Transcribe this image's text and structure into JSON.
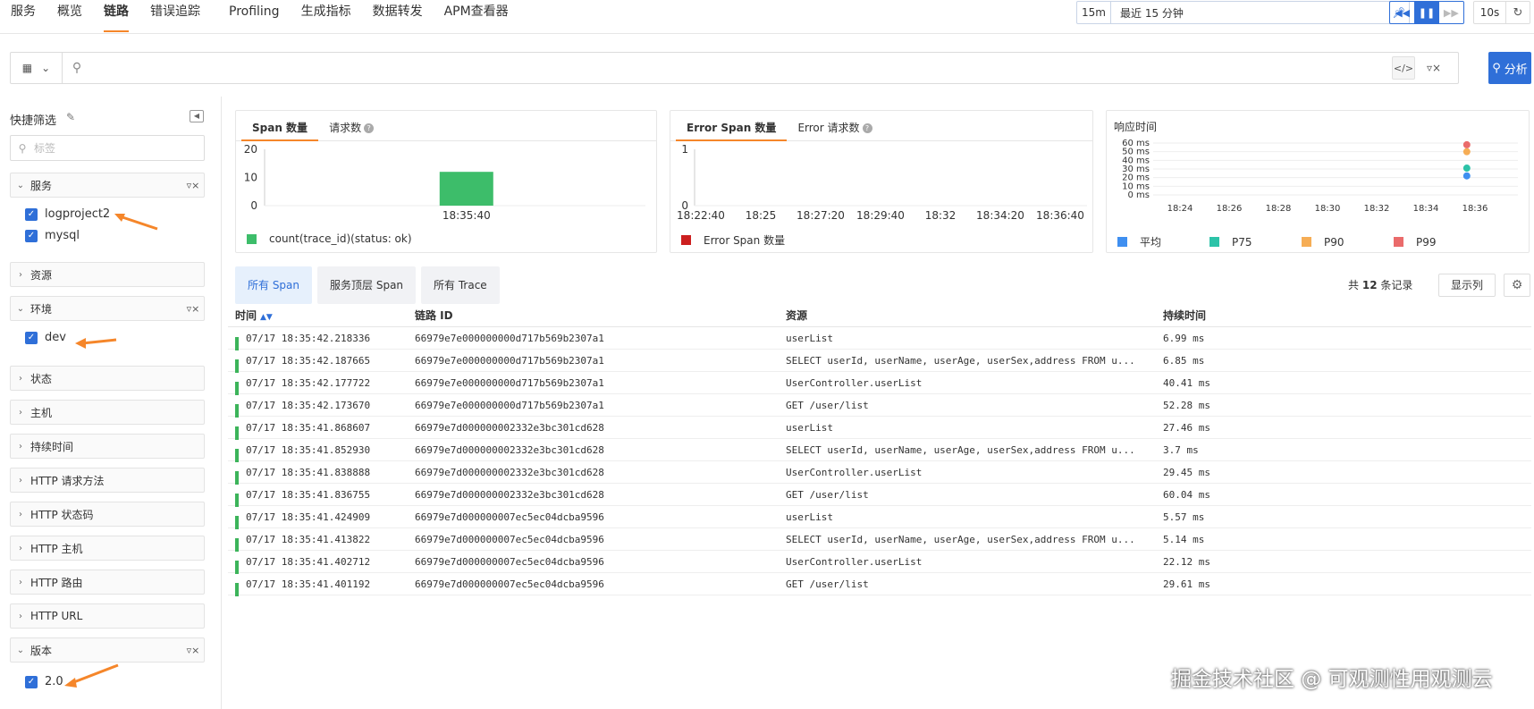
{
  "nav": {
    "tabs": [
      "服务",
      "概览",
      "链路",
      "错误追踪",
      "Profiling",
      "生成指标",
      "数据转发",
      "APM查看器"
    ],
    "active_index": 2
  },
  "time": {
    "short": "15m",
    "label": "最近 15 分钟",
    "refresh": "10s"
  },
  "search": {
    "placeholder": "",
    "analyze_label": "分析"
  },
  "sidebar": {
    "title": "快捷筛选",
    "search_placeholder": "标签",
    "groups": {
      "service": {
        "label": "服务",
        "options": [
          "logproject2",
          "mysql"
        ]
      },
      "resource": {
        "label": "资源"
      },
      "env": {
        "label": "环境",
        "options": [
          "dev"
        ]
      },
      "status": {
        "label": "状态"
      },
      "host": {
        "label": "主机"
      },
      "duration": {
        "label": "持续时间"
      },
      "http_method": {
        "label": "HTTP 请求方法"
      },
      "http_status": {
        "label": "HTTP 状态码"
      },
      "http_host": {
        "label": "HTTP 主机"
      },
      "http_route": {
        "label": "HTTP 路由"
      },
      "http_url": {
        "label": "HTTP URL"
      },
      "version": {
        "label": "版本",
        "options": [
          "2.0"
        ]
      }
    }
  },
  "cards": {
    "span": {
      "tab1": "Span 数量",
      "tab2": "请求数",
      "legend": "count(trace_id)(status: ok)"
    },
    "error": {
      "tab1": "Error Span 数量",
      "tab2": "Error 请求数",
      "legend": "Error Span 数量"
    },
    "resp": {
      "title": "响应时间"
    }
  },
  "chart_data": [
    {
      "type": "bar",
      "categories": [
        "18:35:40"
      ],
      "values": [
        12
      ],
      "ylim": [
        0,
        20
      ],
      "y_ticks": [
        "20",
        "10",
        "0"
      ],
      "x_ticks": [
        "18:35:40"
      ],
      "series": [
        {
          "name": "count(trace_id)(status: ok)",
          "values": [
            12
          ],
          "color": "#3dbd6a"
        }
      ]
    },
    {
      "type": "bar",
      "x_ticks": [
        "18:22:40",
        "18:25",
        "18:27:20",
        "18:29:40",
        "18:32",
        "18:34:20",
        "18:36:40"
      ],
      "y_ticks": [
        "1",
        "0"
      ],
      "ylim": [
        0,
        1
      ],
      "series": [
        {
          "name": "Error Span 数量",
          "values": [],
          "color": "#cc1f1f"
        }
      ]
    },
    {
      "type": "scatter",
      "x_ticks": [
        "18:24",
        "18:26",
        "18:28",
        "18:30",
        "18:32",
        "18:34",
        "18:36"
      ],
      "y_ticks": [
        "60 ms",
        "50 ms",
        "40 ms",
        "30 ms",
        "20 ms",
        "10 ms",
        "0 ms"
      ],
      "ylim": [
        0,
        60
      ],
      "series": [
        {
          "name": "平均",
          "color": "#3f8ff0",
          "points": [
            {
              "x": "18:35:40",
              "y": 22
            }
          ]
        },
        {
          "name": "P75",
          "color": "#2cc3a8",
          "points": [
            {
              "x": "18:35:40",
              "y": 31
            }
          ]
        },
        {
          "name": "P90",
          "color": "#f6ad55",
          "points": [
            {
              "x": "18:35:40",
              "y": 50
            }
          ]
        },
        {
          "name": "P99",
          "color": "#ea6b6b",
          "points": [
            {
              "x": "18:35:40",
              "y": 58
            }
          ]
        }
      ]
    }
  ],
  "span_tabs": [
    "所有 Span",
    "服务顶层 Span",
    "所有 Trace"
  ],
  "total": {
    "prefix": "共",
    "count": "12",
    "suffix": "条记录"
  },
  "display_cols": "显示列",
  "table": {
    "headers": [
      "时间",
      "链路 ID",
      "资源",
      "持续时间"
    ],
    "rows": [
      [
        "07/17 18:35:42.218336",
        "66979e7e000000000d717b569b2307a1",
        "userList",
        "6.99 ms"
      ],
      [
        "07/17 18:35:42.187665",
        "66979e7e000000000d717b569b2307a1",
        "SELECT userId, userName, userAge, userSex,address FROM u...",
        "6.85 ms"
      ],
      [
        "07/17 18:35:42.177722",
        "66979e7e000000000d717b569b2307a1",
        "UserController.userList",
        "40.41 ms"
      ],
      [
        "07/17 18:35:42.173670",
        "66979e7e000000000d717b569b2307a1",
        "GET /user/list",
        "52.28 ms"
      ],
      [
        "07/17 18:35:41.868607",
        "66979e7d000000002332e3bc301cd628",
        "userList",
        "27.46 ms"
      ],
      [
        "07/17 18:35:41.852930",
        "66979e7d000000002332e3bc301cd628",
        "SELECT userId, userName, userAge, userSex,address FROM u...",
        "3.7 ms"
      ],
      [
        "07/17 18:35:41.838888",
        "66979e7d000000002332e3bc301cd628",
        "UserController.userList",
        "29.45 ms"
      ],
      [
        "07/17 18:35:41.836755",
        "66979e7d000000002332e3bc301cd628",
        "GET /user/list",
        "60.04 ms"
      ],
      [
        "07/17 18:35:41.424909",
        "66979e7d000000007ec5ec04dcba9596",
        "userList",
        "5.57 ms"
      ],
      [
        "07/17 18:35:41.413822",
        "66979e7d000000007ec5ec04dcba9596",
        "SELECT userId, userName, userAge, userSex,address FROM u...",
        "5.14 ms"
      ],
      [
        "07/17 18:35:41.402712",
        "66979e7d000000007ec5ec04dcba9596",
        "UserController.userList",
        "22.12 ms"
      ],
      [
        "07/17 18:35:41.401192",
        "66979e7d000000007ec5ec04dcba9596",
        "GET /user/list",
        "29.61 ms"
      ]
    ]
  },
  "watermark": "掘金技术社区 @ 可观测性用观测云"
}
